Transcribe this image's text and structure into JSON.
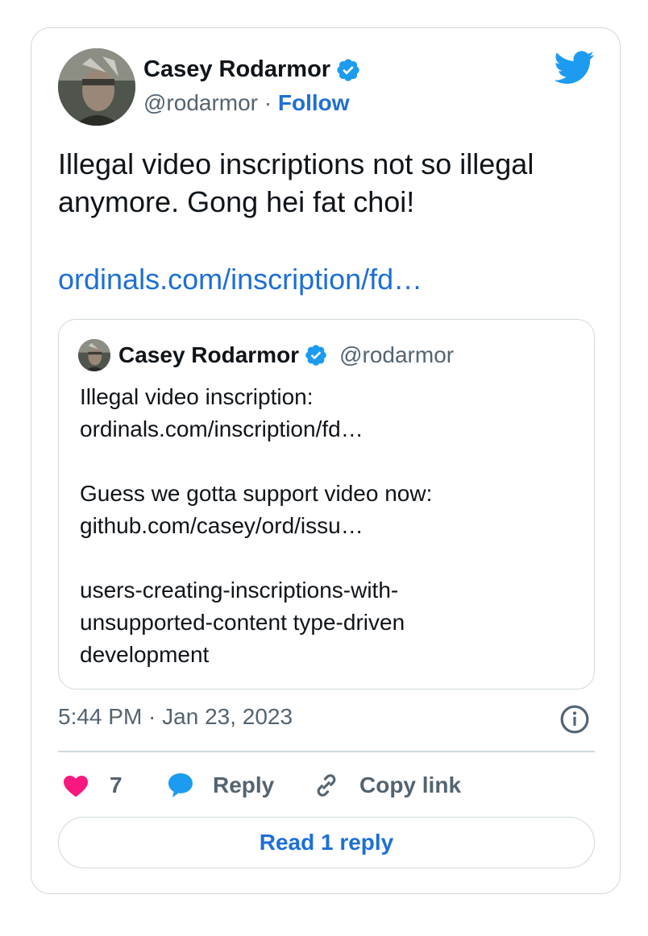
{
  "author": {
    "name": "Casey Rodarmor",
    "handle": "@rodarmor",
    "separator": "·",
    "follow_label": "Follow"
  },
  "tweet": {
    "text": "Illegal video inscriptions not so illegal anymore. Gong hei fat choi!",
    "link": "ordinals.com/inscription/fd…"
  },
  "quoted_tweet": {
    "name": "Casey Rodarmor",
    "handle": "@rodarmor",
    "lines": [
      "Illegal video inscription:",
      "ordinals.com/inscription/fd…",
      "",
      "Guess we gotta support video now:",
      "github.com/casey/ord/issu…",
      "",
      "users-creating-inscriptions-with-",
      "unsupported-content type-driven",
      "development"
    ]
  },
  "meta": {
    "timestamp": "5:44 PM · Jan 23, 2023"
  },
  "actions": {
    "like_count": "7",
    "reply_label": "Reply",
    "copy_link_label": "Copy link"
  },
  "read_replies_label": "Read 1 reply",
  "colors": {
    "link_blue": "#1d6fd6",
    "twitter_blue": "#1d9bf0",
    "heart_pink": "#f91880",
    "secondary_text": "#536471",
    "border": "#cfd9de"
  },
  "icons": {
    "verified": "verified-badge-icon",
    "logo": "twitter-bird-icon",
    "info": "info-icon",
    "like": "heart-icon",
    "reply": "speech-bubble-icon",
    "copy": "link-chain-icon"
  }
}
